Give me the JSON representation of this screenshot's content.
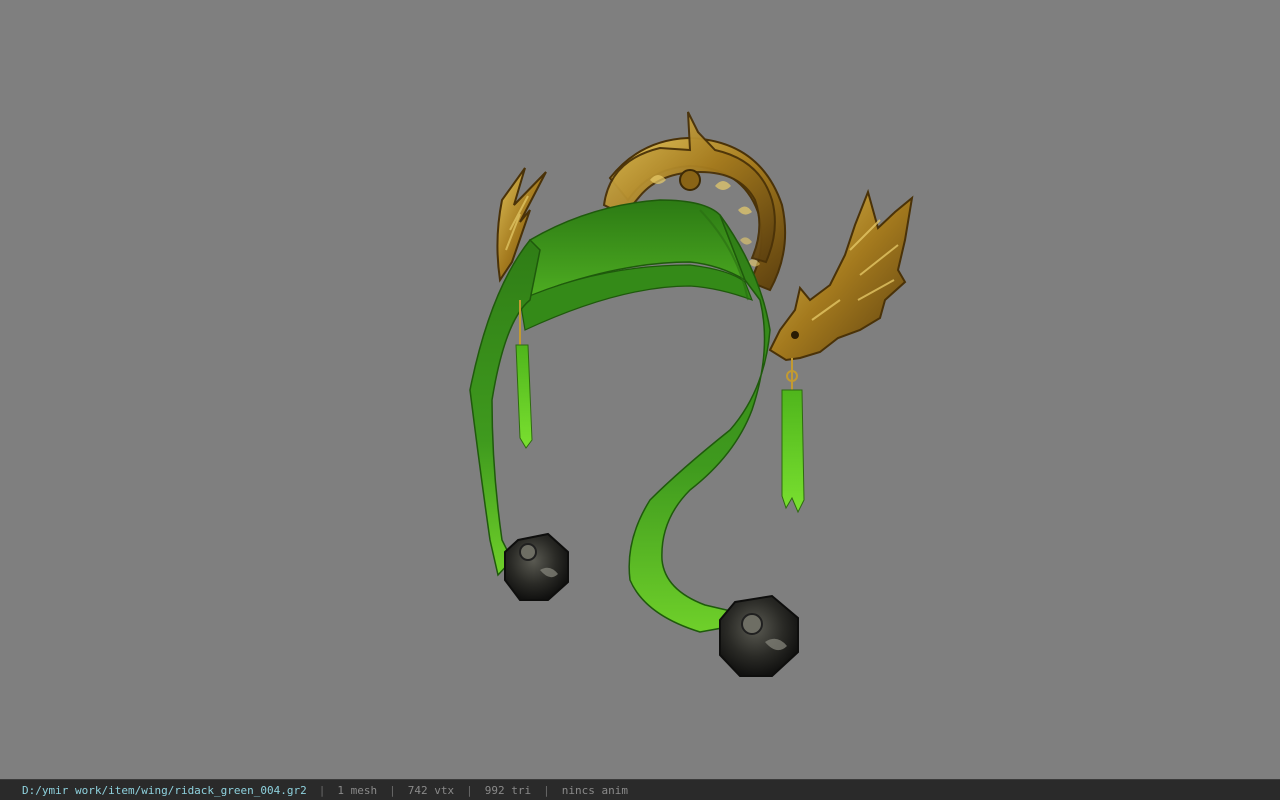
{
  "viewport": {
    "background": "#7f7f7f",
    "model_parts": [
      "gold-crest",
      "green-ribbon-band",
      "left-gold-wing",
      "right-dragon-head",
      "left-jade-tassel",
      "right-jade-tassel",
      "left-bead-ornament",
      "right-bead-ornament"
    ]
  },
  "status": {
    "path": "D:/ymir work/item/wing/ridack_green_004.gr2",
    "separator": "|",
    "mesh": "1 mesh",
    "vertices": "742 vtx",
    "triangles": "992 tri",
    "animation": "nincs anim"
  },
  "colors": {
    "status_bg": "#2a2a2a",
    "path_color": "#8ed1dd",
    "text_color": "#8a8a8a",
    "ribbon_green": "#3f9a1e",
    "gold": "#b08a2a"
  }
}
